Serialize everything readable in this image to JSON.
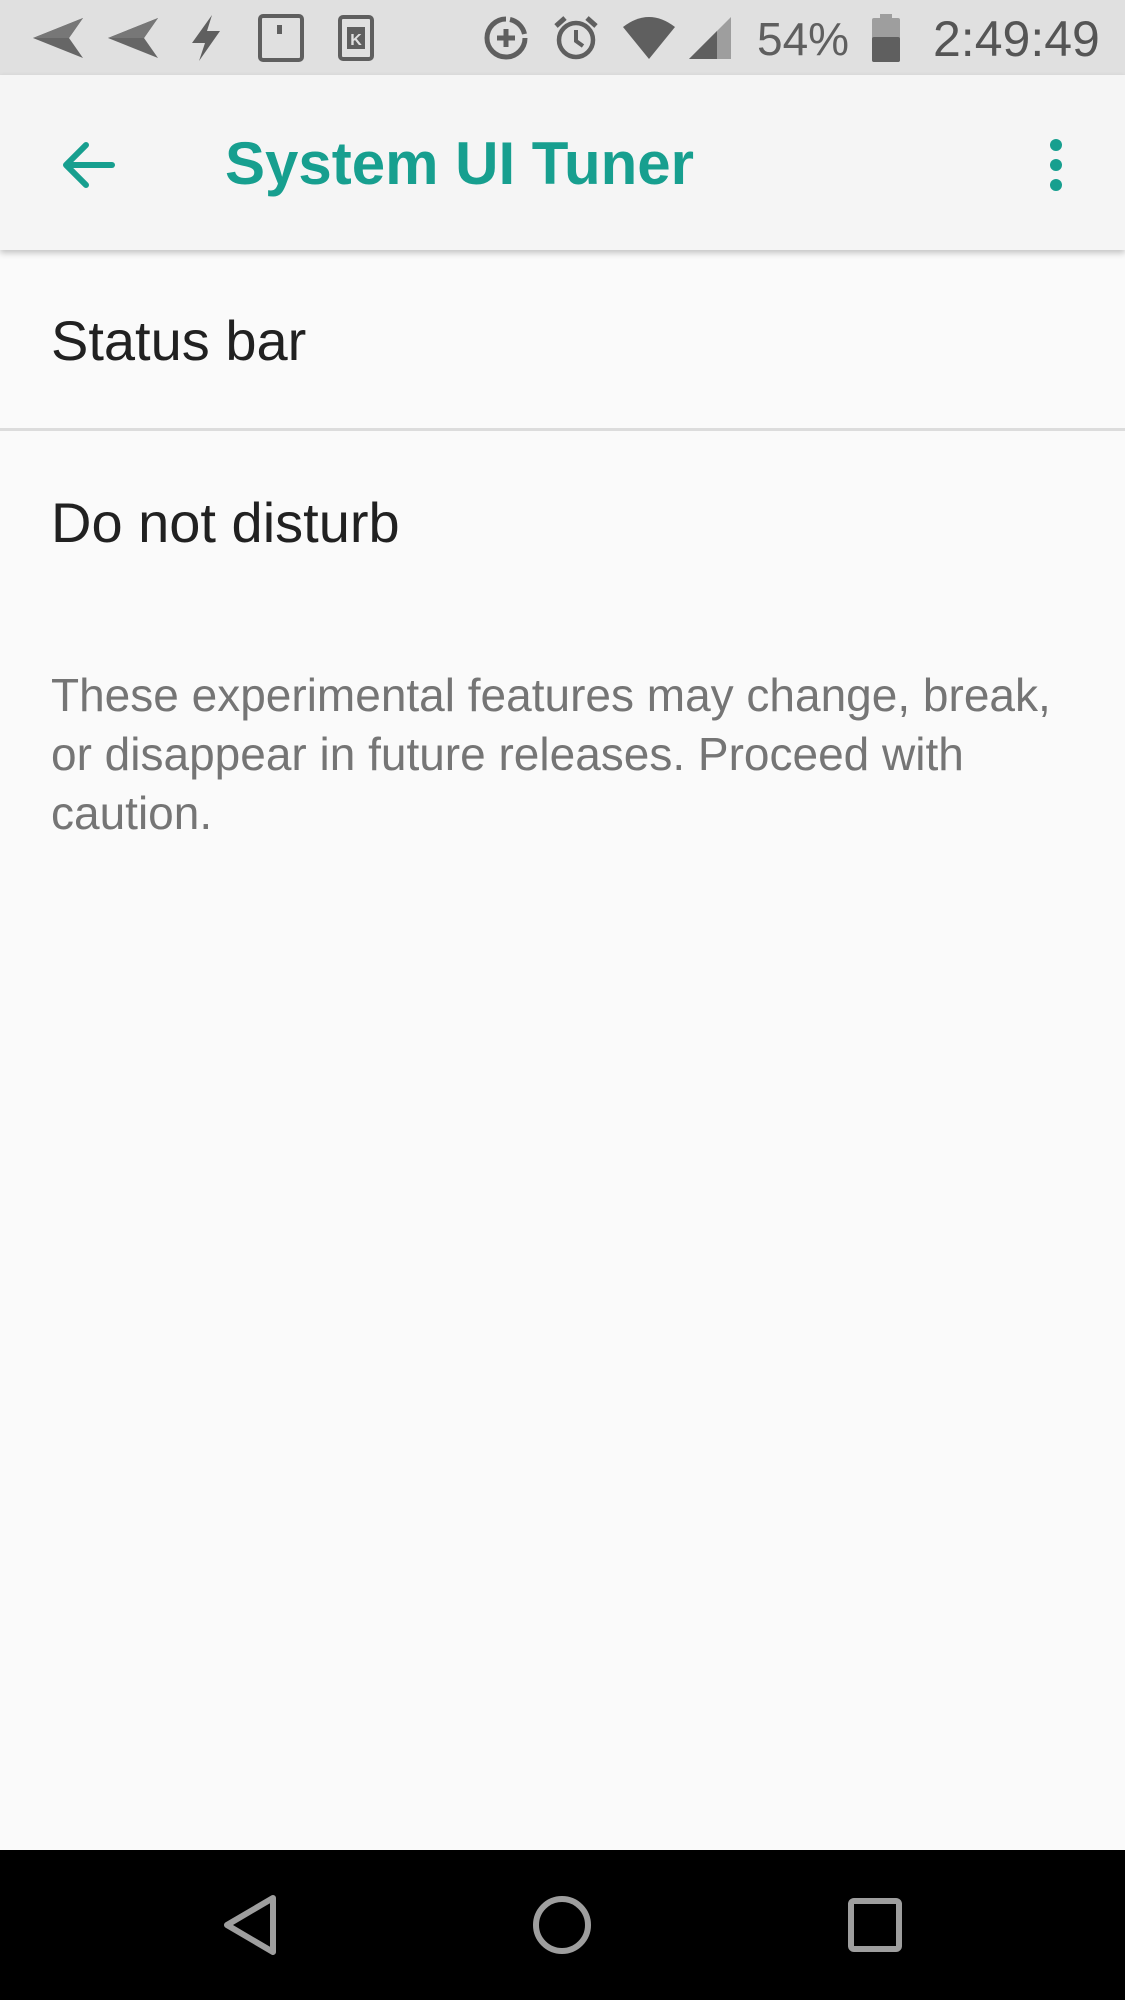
{
  "status_bar": {
    "icons": [
      "send-icon",
      "send-icon",
      "flash-icon",
      "sim-card-icon",
      "keyboard-icon",
      "data-saver-icon",
      "alarm-icon",
      "wifi-icon",
      "cellular-signal-icon",
      "battery-icon"
    ],
    "battery_percent": "54%",
    "time": "2:49:49"
  },
  "app_bar": {
    "title": "System UI Tuner",
    "back_icon": "arrow-back-icon",
    "menu_icon": "more-vert-icon",
    "accent_color": "#179f8f"
  },
  "list": {
    "items": [
      {
        "label": "Status bar"
      },
      {
        "label": "Do not disturb"
      }
    ],
    "footer_note": "These experimental features may change, break, or disappear in future releases. Proceed with caution."
  },
  "nav_bar": {
    "buttons": [
      "back-triangle-icon",
      "home-circle-icon",
      "recents-square-icon"
    ]
  }
}
